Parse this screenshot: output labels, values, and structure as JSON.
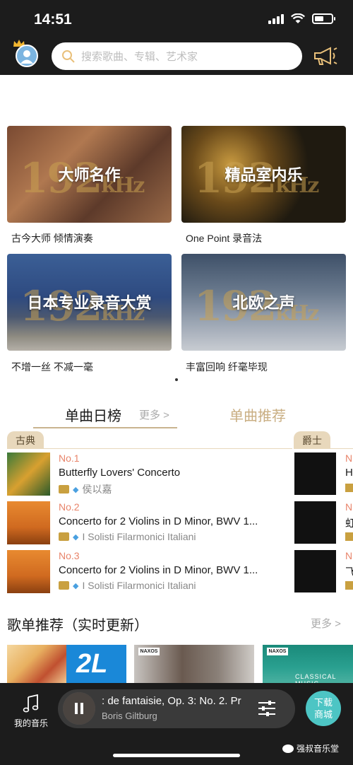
{
  "status": {
    "time": "14:51",
    "battery_level": 0.55
  },
  "header": {
    "search_placeholder": "搜索歌曲、专辑、艺术家",
    "avatar_icon": "user-avatar-icon",
    "crown_icon": "crown-icon",
    "announce_icon": "megaphone-icon"
  },
  "tiles": [
    {
      "title": "大师名作",
      "subtitle": "古今大师 倾情演奏",
      "overlay": "192",
      "unit": "kHz"
    },
    {
      "title": "精品室内乐",
      "subtitle": "One Point 录音法",
      "overlay": "192",
      "unit": "kHz"
    },
    {
      "title": "日本专业录音大赏",
      "subtitle": "不增一丝 不减一毫",
      "overlay": "192",
      "unit": "kHz"
    },
    {
      "title": "北欧之声",
      "subtitle": "丰富回响 纤毫毕现",
      "overlay": "192",
      "unit": "kHz"
    }
  ],
  "charts": {
    "tab_daily": "单曲日榜",
    "more": "更多 >",
    "tab_recommend": "单曲推荐",
    "genre_classical": "古典",
    "genre_jazz": "爵士",
    "songs": [
      {
        "rank": "No.1",
        "name": "Butterfly Lovers' Concerto",
        "artist": "侯以嘉"
      },
      {
        "rank": "No.2",
        "name": "Concerto for 2 Violins in D Minor, BWV 1...",
        "artist": "I Solisti Filarmonici Italiani"
      },
      {
        "rank": "No.3",
        "name": "Concerto for 2 Violins in D Minor, BWV 1...",
        "artist": "I Solisti Filarmonici Italiani"
      }
    ],
    "jazz": [
      {
        "rank": "N",
        "name": "H"
      },
      {
        "rank": "N",
        "name": "虹"
      },
      {
        "rank": "N",
        "name": "飞"
      }
    ]
  },
  "playlists": {
    "title": "歌单推荐（实时更新）",
    "more": "更多 >",
    "card_labels": [
      "2L",
      "NAXOS",
      "NAXOS",
      "CLASSICAL MUSIC"
    ]
  },
  "player": {
    "my_music": "我的音乐",
    "track": ": de fantaisie, Op. 3: No. 2. Pr",
    "artist": "Boris Giltburg",
    "store_label_1": "下载",
    "store_label_2": "商城"
  },
  "watermark": "强叔音乐堂"
}
